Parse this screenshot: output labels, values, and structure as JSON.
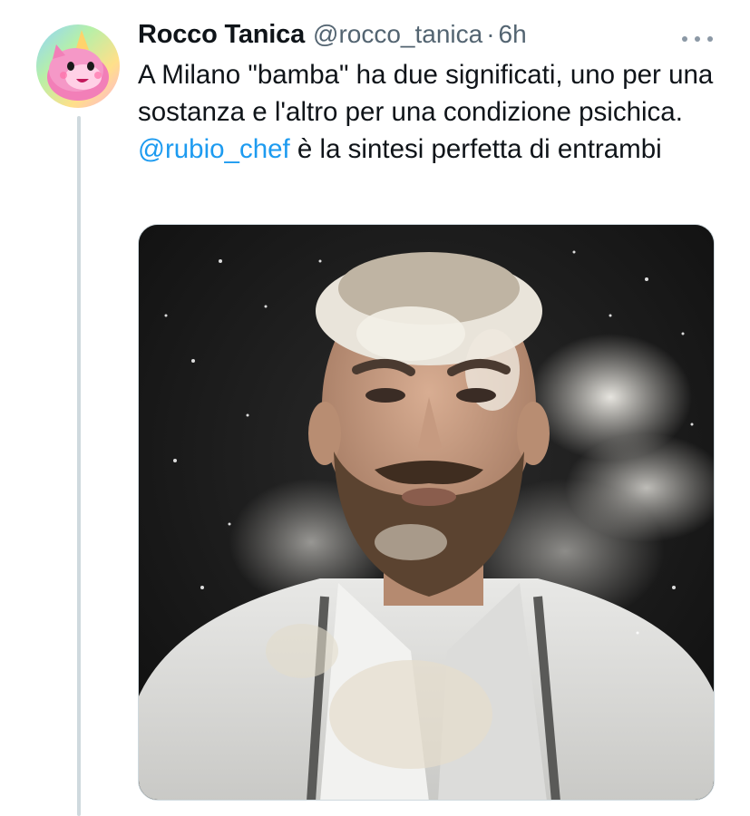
{
  "tweet": {
    "author": {
      "display_name": "Rocco Tanica",
      "handle": "@rocco_tanica",
      "separator": "·",
      "time": "6h",
      "avatar_icon": "pink-unicorn-avatar"
    },
    "more_icon": "more-options-icon",
    "text_parts": {
      "part1": "A Milano \"bamba\" ha due significati, uno per una sostanza e l'altro per una condizione psichica. ",
      "mention": "@rubio_chef",
      "part2": " è la sintesi perfetta di entrambi"
    },
    "media": {
      "kind": "photo",
      "subject": "bearded chef in white jacket and apron covered in flour against dark background"
    }
  },
  "colors": {
    "text": "#0f1419",
    "secondary": "#536471",
    "link": "#1d9bf0",
    "thread_line": "#cfd9de"
  }
}
